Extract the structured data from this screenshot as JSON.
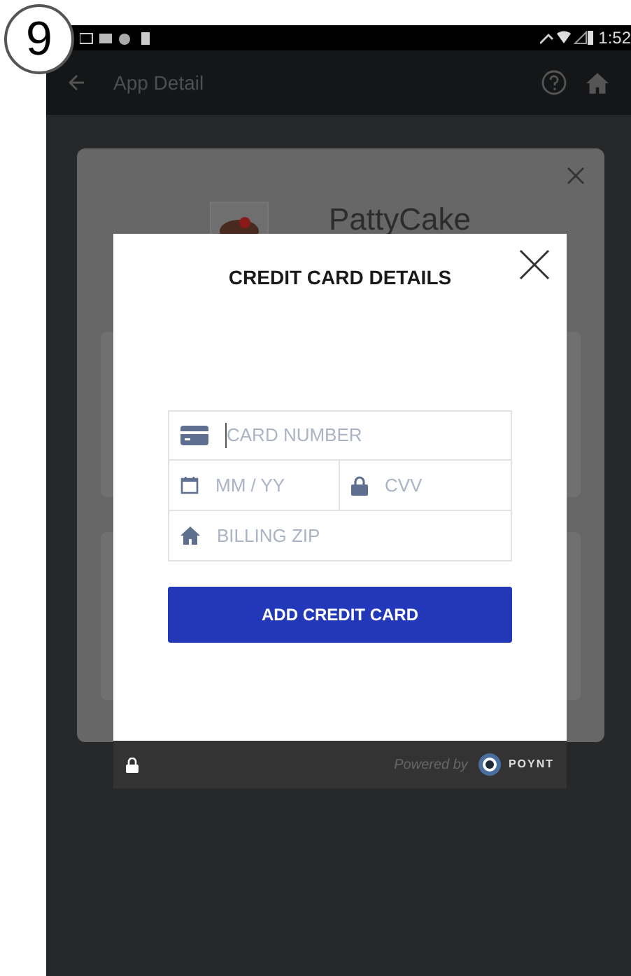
{
  "step_marker": "9",
  "status_bar": {
    "time": "1:52"
  },
  "app_bar": {
    "title": "App Detail"
  },
  "app_dialog": {
    "app_name": "PattyCake"
  },
  "card_dialog": {
    "title": "CREDIT CARD DETAILS",
    "fields": [
      {
        "kind": "card",
        "placeholder": "CARD NUMBER",
        "focused": true
      },
      {
        "kind": "expiry",
        "placeholder": "MM / YY",
        "focused": false
      },
      {
        "kind": "cvv",
        "placeholder": "CVV",
        "focused": false
      },
      {
        "kind": "zip",
        "placeholder": "BILLING ZIP",
        "focused": false
      }
    ],
    "submit": "ADD CREDIT CARD"
  },
  "footer": {
    "powered_by": "Powered by",
    "brand": "POYNT"
  }
}
